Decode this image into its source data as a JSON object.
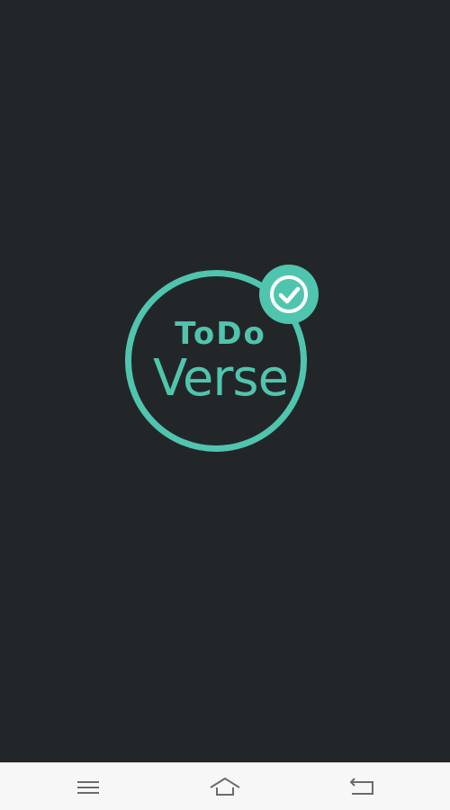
{
  "app": {
    "logo_line_1": "ToDo",
    "logo_line_2": "Verse"
  },
  "icons": {
    "logo_badge": "check-circle-icon",
    "nav_menu": "menu-icon",
    "nav_home": "home-icon",
    "nav_back": "back-icon"
  },
  "colors": {
    "background": "#232629",
    "accent": "#50c5ad",
    "nav_bar": "#f7f7f7",
    "nav_icon": "#6b6b6b"
  }
}
